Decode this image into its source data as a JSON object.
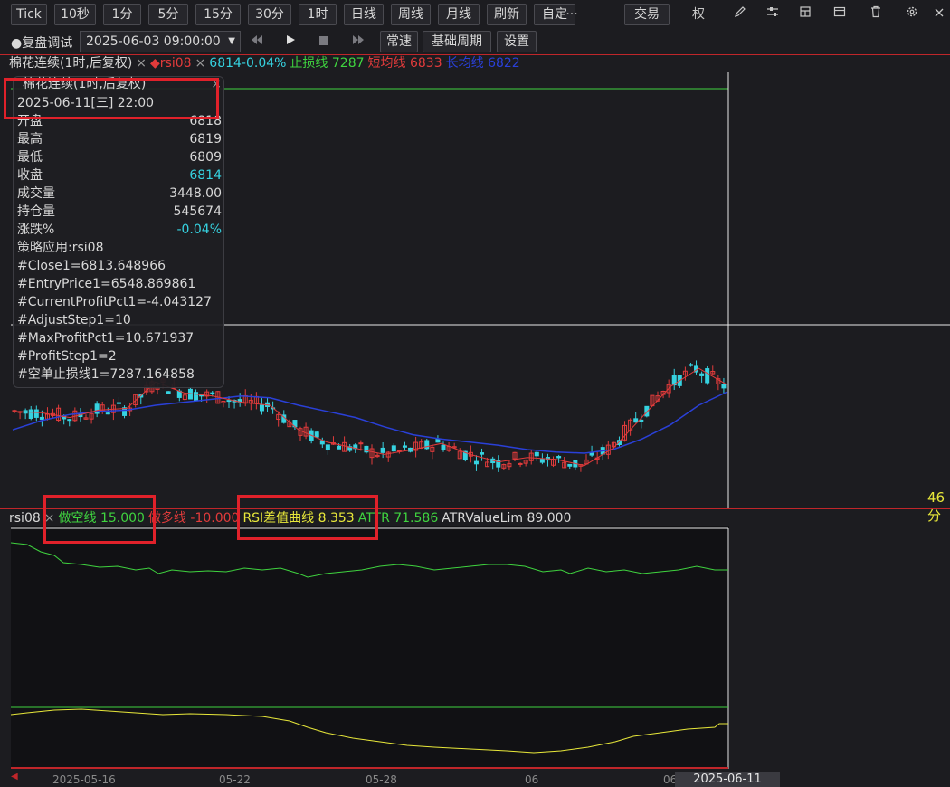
{
  "toolbar": {
    "periods": [
      "Tick",
      "10秒",
      "1分",
      "5分",
      "15分",
      "30分",
      "1时",
      "日线",
      "周线",
      "月线",
      "刷新",
      "自定"
    ],
    "more": "···",
    "trade": "交易",
    "quan": "权"
  },
  "replay": {
    "label": "●复盘调试",
    "datetime": "2025-06-03 09:00:00",
    "speed": "常速",
    "base_period": "基础周期",
    "settings": "设置"
  },
  "main_legend": {
    "instrument": "棉花连续(1时,后复权)",
    "close_x": "×",
    "strategy": "◆rsi08",
    "close_x2": "×",
    "price_change": "6814-0.04%",
    "stop_line": "止损线 7287",
    "short_ma": "短均线 6833",
    "long_ma": "长均线 6822"
  },
  "tooltip": {
    "title": "棉花连续(1时,后复权)",
    "close": "×",
    "datetime": "2025-06-11[三] 22:00",
    "rows": [
      {
        "label": "开盘",
        "value": "6818"
      },
      {
        "label": "最高",
        "value": "6819"
      },
      {
        "label": "最低",
        "value": "6809"
      },
      {
        "label": "收盘",
        "value": "6814"
      },
      {
        "label": "成交量",
        "value": "3448.00"
      },
      {
        "label": "持仓量",
        "value": "545674"
      },
      {
        "label": "涨跌%",
        "value": "-0.04%"
      }
    ],
    "lines": [
      "策略应用:rsi08",
      "#Close1=6813.648966",
      "#EntryPrice1=6548.869861",
      "#CurrentProfitPct1=-4.043127",
      "#AdjustStep1=10",
      "#MaxProfitPct1=10.671937",
      "#ProfitStep1=2",
      "#空单止损线1=7287.164858"
    ]
  },
  "right_label": "46分",
  "sub_legend": {
    "name": "rsi08",
    "close_x": "×",
    "short_line": "做空线 15.000",
    "long_line": "做多线 -10.000",
    "rsi_diff": "RSI差值曲线 8.353",
    "attr": "ATTR 71.586",
    "atr_lim": "ATRValueLim 89.000"
  },
  "x_axis": {
    "labels": [
      "2025-05-16",
      "05-22",
      "05-28",
      "06",
      "06"
    ],
    "cursor": "2025-06-11 22:00"
  },
  "colors": {
    "up": "#e23b3b",
    "down": "#36d2e0",
    "green": "#3fd33f",
    "yellow": "#e8e83a",
    "blue": "#2a40d8",
    "red_line": "#c0262a",
    "highlight": "#e0212a"
  },
  "chart_data": {
    "type": "candlestick",
    "series": [
      {
        "name": "长均线",
        "values": [
          6760,
          6775,
          6785,
          6790,
          6792,
          6800,
          6805,
          6810,
          6815,
          6812,
          6800,
          6790,
          6780,
          6765,
          6752,
          6745,
          6740,
          6735,
          6728,
          6724,
          6722,
          6728,
          6745,
          6768,
          6800,
          6822
        ]
      },
      {
        "name": "短均线",
        "values": [
          6790,
          6788,
          6780,
          6792,
          6795,
          6838,
          6820,
          6815,
          6805,
          6800,
          6760,
          6740,
          6730,
          6720,
          6728,
          6738,
          6720,
          6708,
          6715,
          6712,
          6702,
          6730,
          6780,
          6830,
          6860,
          6833
        ]
      }
    ],
    "sub_series": [
      {
        "name": "做空线",
        "value": 15.0
      },
      {
        "name": "做多线",
        "value": -10.0
      },
      {
        "name": "RSI差值曲线",
        "value": 8.353
      },
      {
        "name": "ATTR",
        "value": 71.586
      },
      {
        "name": "ATRValueLim",
        "value": 89.0
      }
    ]
  }
}
